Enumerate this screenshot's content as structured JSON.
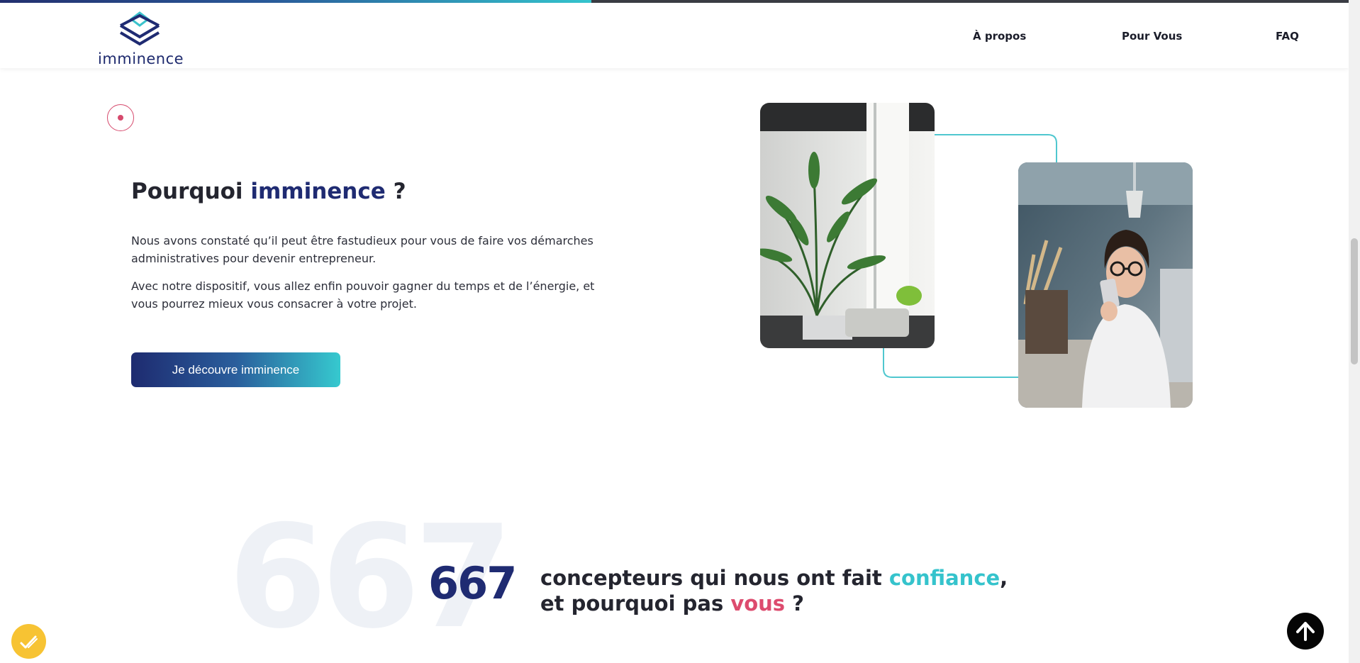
{
  "header": {
    "logo_text": "imminence",
    "nav": [
      {
        "label": "À propos"
      },
      {
        "label": "Pour Vous"
      },
      {
        "label": "FAQ"
      }
    ]
  },
  "hero": {
    "title_prefix": "Pourquoi ",
    "title_brand": "imminence",
    "title_suffix": " ?",
    "paragraph1": "Nous avons constaté qu’il peut être fastudieux pour vous de faire vos démarches administratives pour devenir entrepreneur.",
    "paragraph2": "Avec notre dispositif, vous allez enfin pouvoir gagner du temps et de l’énergie, et vous pourrez mieux vous consacrer à votre projet.",
    "cta_label": "Je découvre imminence"
  },
  "stats": {
    "ghost_number": "667",
    "count": "667",
    "line1_prefix": "concepteurs qui nous ont fait ",
    "line1_highlight": "confiance",
    "line1_suffix": ",",
    "line2_prefix": "et pourquoi pas ",
    "line2_highlight": "vous",
    "line2_suffix": " ?"
  },
  "colors": {
    "brand_navy": "#1f2b72",
    "brand_teal": "#35c3cc",
    "accent_pink": "#dd4b6e",
    "badge_yellow": "#f7c333"
  },
  "icons": {
    "logo": "stacked-diamond-logo-icon",
    "section_marker": "target-dot-icon",
    "to_top": "arrow-up-icon",
    "badge": "checkmark-badge-icon"
  }
}
